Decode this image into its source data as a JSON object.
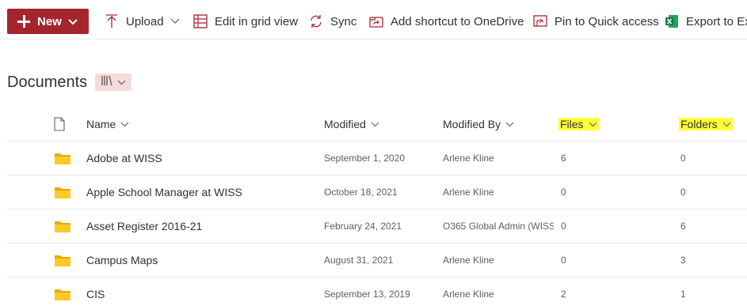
{
  "command_bar": {
    "new_label": "New",
    "upload_label": "Upload",
    "grid_label": "Edit in grid view",
    "sync_label": "Sync",
    "shortcut_label": "Add shortcut to OneDrive",
    "pin_label": "Pin to Quick access",
    "export_label": "Export to Exc"
  },
  "library": {
    "title": "Documents"
  },
  "columns": {
    "name": "Name",
    "modified": "Modified",
    "modified_by": "Modified By",
    "files": "Files",
    "folders": "Folders"
  },
  "rows": [
    {
      "name": "Adobe at WISS",
      "modified": "September 1, 2020",
      "modified_by": "Arlene Kline",
      "files": "6",
      "folders": "0"
    },
    {
      "name": "Apple School Manager at WISS",
      "modified": "October 18, 2021",
      "modified_by": "Arlene Kline",
      "files": "0",
      "folders": "0"
    },
    {
      "name": "Asset Register 2016-21",
      "modified": "February 24, 2021",
      "modified_by": "O365 Global Admin (WISS",
      "files": "0",
      "folders": "6"
    },
    {
      "name": "Campus Maps",
      "modified": "August 31, 2021",
      "modified_by": "Arlene Kline",
      "files": "0",
      "folders": "3"
    },
    {
      "name": "CIS",
      "modified": "September 13, 2019",
      "modified_by": "Arlene Kline",
      "files": "2",
      "folders": "1"
    }
  ],
  "colors": {
    "accent": "#a4262c",
    "highlight": "#ffff3a",
    "folder": "#ffca28",
    "view_switch_bg": "#f4dcdc"
  },
  "icons": {
    "new": "plus-icon",
    "upload": "upload-arrow-icon",
    "grid": "grid-icon",
    "sync": "sync-icon",
    "shortcut": "shortcut-icon",
    "pin": "pin-icon",
    "export": "excel-icon",
    "file_type": "document-icon",
    "folder": "folder-icon",
    "view": "library-view-icon"
  }
}
